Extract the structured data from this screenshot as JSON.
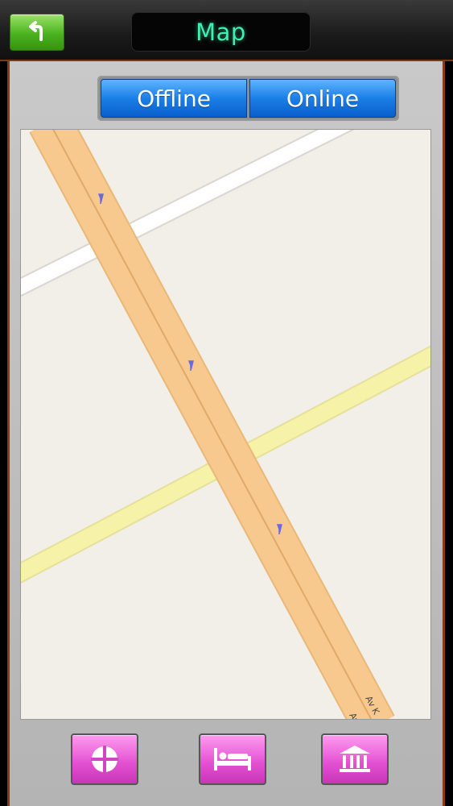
{
  "header": {
    "title": "Map",
    "back_icon": "back-arrow-icon"
  },
  "map_mode": {
    "options": [
      "Offline",
      "Online"
    ],
    "selected": "Offline"
  },
  "map": {
    "road_labels": [
      "Av",
      "Av K"
    ],
    "colors": {
      "background": "#f2efe9",
      "main_road": "#f7c98f",
      "secondary_road": "#f6f2a8",
      "minor_road": "#ffffff",
      "oneway_arrow": "#6a6ad8"
    }
  },
  "bottom_bar": {
    "buttons": [
      {
        "icon": "compass-crosshair-icon"
      },
      {
        "icon": "hotel-bed-icon"
      },
      {
        "icon": "museum-icon"
      }
    ]
  },
  "colors": {
    "accent_green": "#4bb21f",
    "title_text": "#3ff0b0",
    "segment_blue": "#1a7fe8",
    "button_pink": "#e24fd0",
    "frame_orange": "#8a3b10"
  }
}
